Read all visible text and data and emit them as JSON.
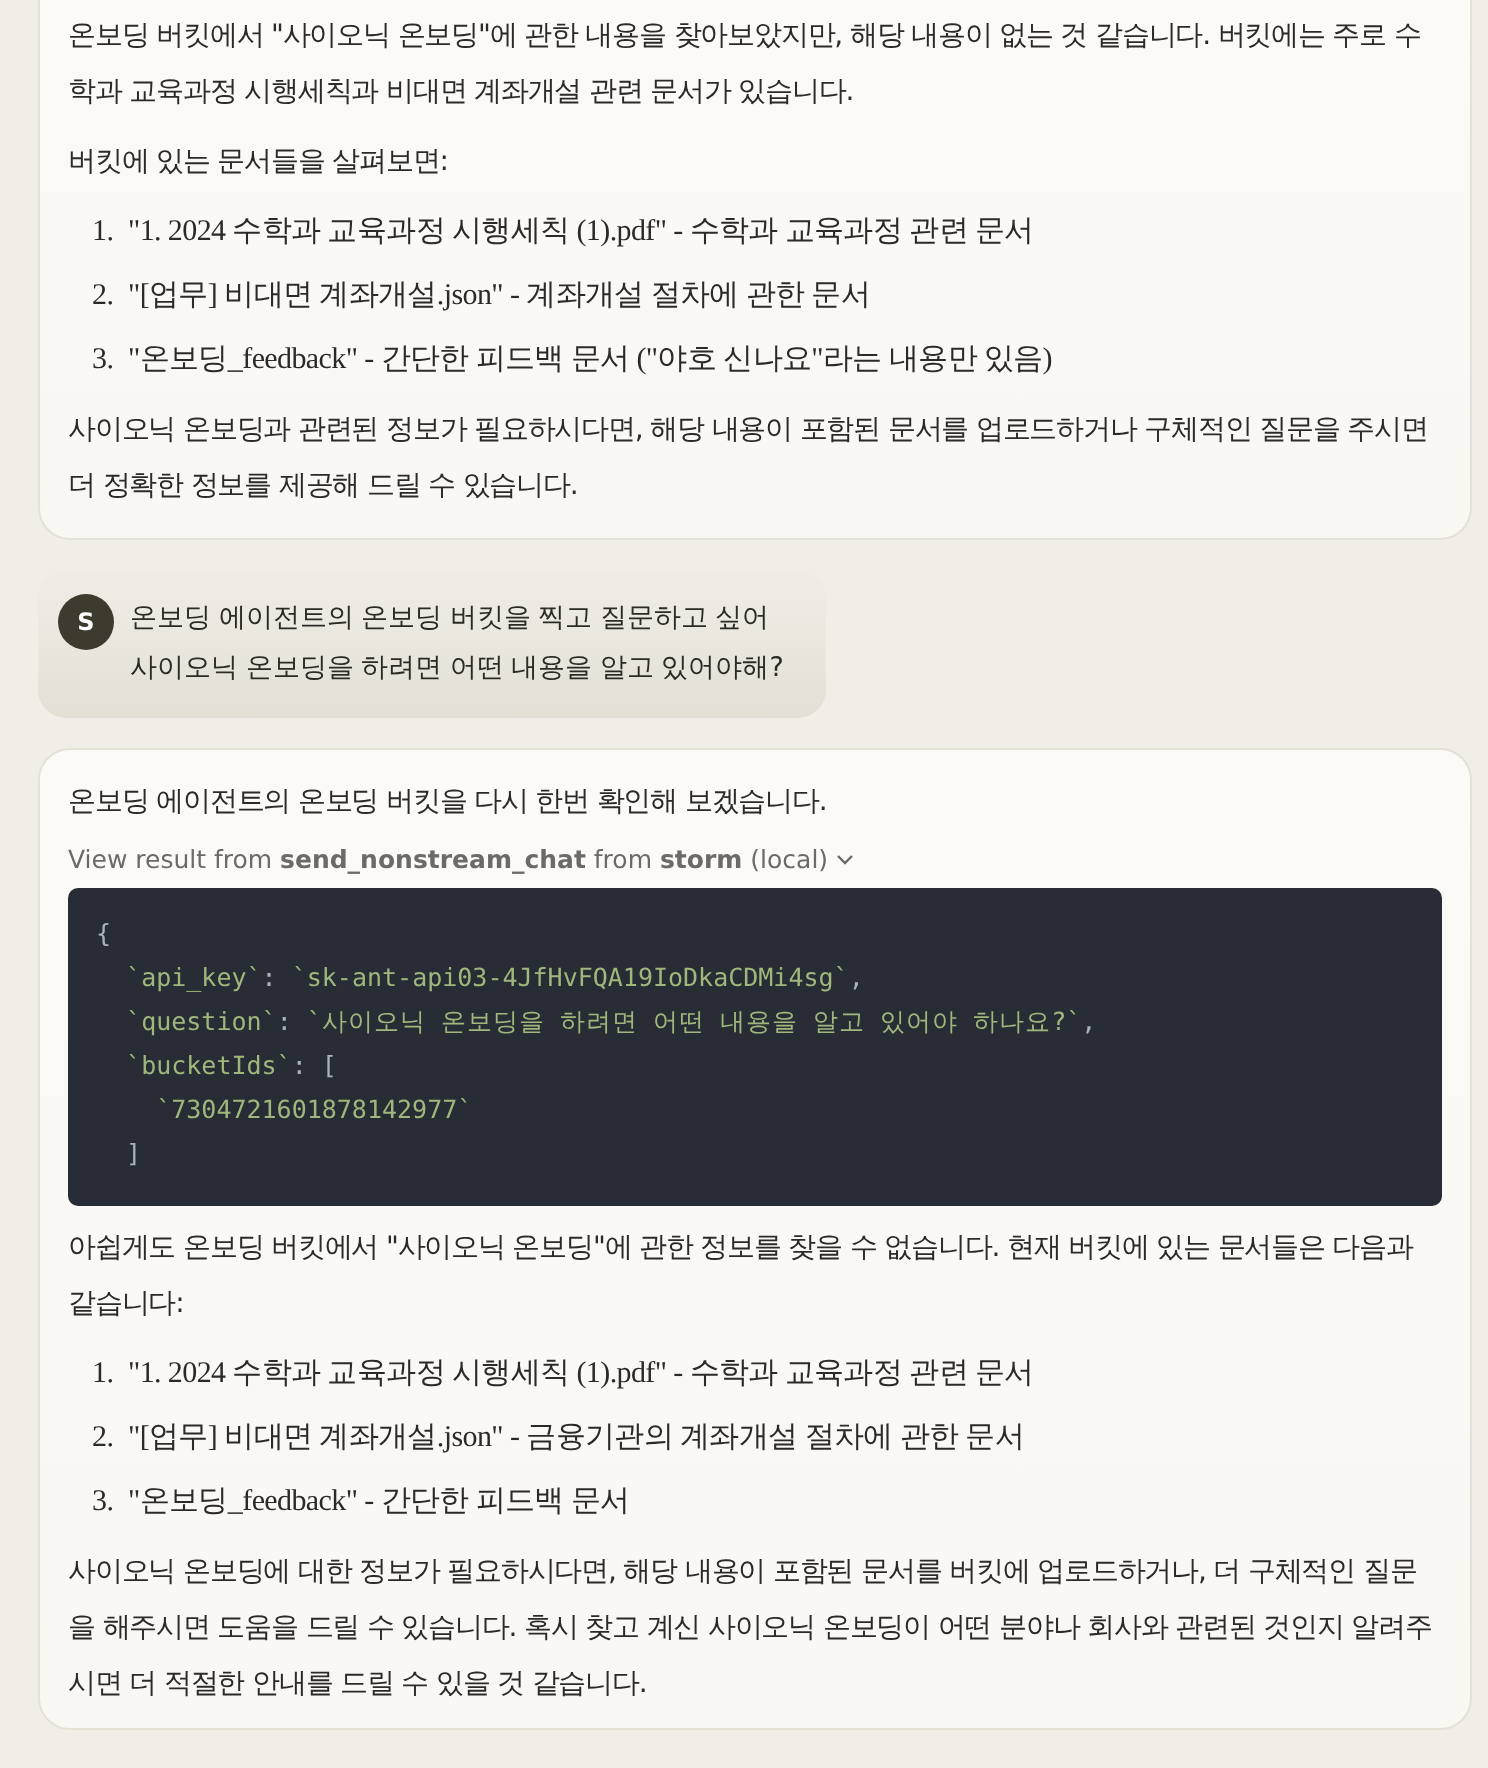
{
  "messages": [
    {
      "kind": "assistant",
      "blocks": [
        {
          "kind": "para",
          "text": "온보딩 버킷에서 \"사이오닉 온보딩\"에 관한 내용을 찾아보았지만, 해당 내용이 없는 것 같습니다. 버킷에는 주로 수학과 교육과정 시행세칙과 비대면 계좌개설 관련 문서가 있습니다."
        },
        {
          "kind": "para",
          "text": "버킷에 있는 문서들을 살펴보면:"
        },
        {
          "kind": "list",
          "items": [
            {
              "number": "1.",
              "text": "\"1. 2024 수학과 교육과정 시행세칙 (1).pdf\" - 수학과 교육과정 관련 문서"
            },
            {
              "number": "2.",
              "text": "\"[업무] 비대면 계좌개설.json\" - 계좌개설 절차에 관한 문서"
            },
            {
              "number": "3.",
              "text": "\"온보딩_feedback\" - 간단한 피드백 문서 (\"야호 신나요\"라는 내용만 있음)"
            }
          ]
        },
        {
          "kind": "para",
          "text": "사이오닉 온보딩과 관련된 정보가 필요하시다면, 해당 내용이 포함된 문서를 업로드하거나 구체적인 질문을 주시면 더 정확한 정보를 제공해 드릴 수 있습니다."
        }
      ]
    },
    {
      "kind": "user",
      "avatar": "S",
      "lines": [
        "온보딩 에이전트의 온보딩 버킷을 찍고 질문하고 싶어",
        "사이오닉 온보딩을 하려면 어떤 내용을 알고 있어야해?"
      ]
    },
    {
      "kind": "assistant",
      "blocks": [
        {
          "kind": "para",
          "text": "온보딩 에이전트의 온보딩 버킷을 다시 한번 확인해 보겠습니다."
        },
        {
          "kind": "tool",
          "text": "View result from **send_nonstream_chat** from **storm** (local)",
          "expanded": true
        },
        {
          "kind": "code",
          "lines": [
            [
              {
                "kind": "punct",
                "text": "{"
              }
            ],
            [
              {
                "kind": "string",
                "text": "  `api_key`"
              },
              {
                "kind": "punct",
                "text": ": "
              },
              {
                "kind": "string",
                "text": "`sk-ant-api03-4JfHvFQA19IoDkaCDMi4sg`"
              },
              {
                "kind": "punct",
                "text": ","
              }
            ],
            [
              {
                "kind": "string",
                "text": "  `question`"
              },
              {
                "kind": "punct",
                "text": ": "
              },
              {
                "kind": "string",
                "text": "`사이오닉 온보딩을 하려면 어떤 내용을 알고 있어야 하나요?`"
              },
              {
                "kind": "punct",
                "text": ","
              }
            ],
            [
              {
                "kind": "string",
                "text": "  `bucketIds`"
              },
              {
                "kind": "punct",
                "text": ": ["
              }
            ],
            [
              {
                "kind": "string",
                "text": "    `7304721601878142977`"
              }
            ],
            [
              {
                "kind": "punct",
                "text": "  ]"
              }
            ]
          ]
        },
        {
          "kind": "para",
          "text": "아쉽게도 온보딩 버킷에서 \"사이오닉 온보딩\"에 관한 정보를 찾을 수 없습니다. 현재 버킷에 있는 문서들은 다음과 같습니다:"
        },
        {
          "kind": "list",
          "items": [
            {
              "number": "1.",
              "text": "\"1. 2024 수학과 교육과정 시행세칙 (1).pdf\" - 수학과 교육과정 관련 문서"
            },
            {
              "number": "2.",
              "text": "\"[업무] 비대면 계좌개설.json\" - 금융기관의 계좌개설 절차에 관한 문서"
            },
            {
              "number": "3.",
              "text": "\"온보딩_feedback\" - 간단한 피드백 문서"
            }
          ]
        },
        {
          "kind": "para",
          "text": "사이오닉 온보딩에 대한 정보가 필요하시다면, 해당 내용이 포함된 문서를 버킷에 업로드하거나, 더 구체적인 질문을 해주시면 도움을 드릴 수 있습니다. 혹시 찾고 계신 사이오닉 온보딩이 어떤 분야나 회사와 관련된 것인지 알려주시면 더 적절한 안내를 드릴 수 있을 것 같습니다."
        }
      ]
    }
  ]
}
